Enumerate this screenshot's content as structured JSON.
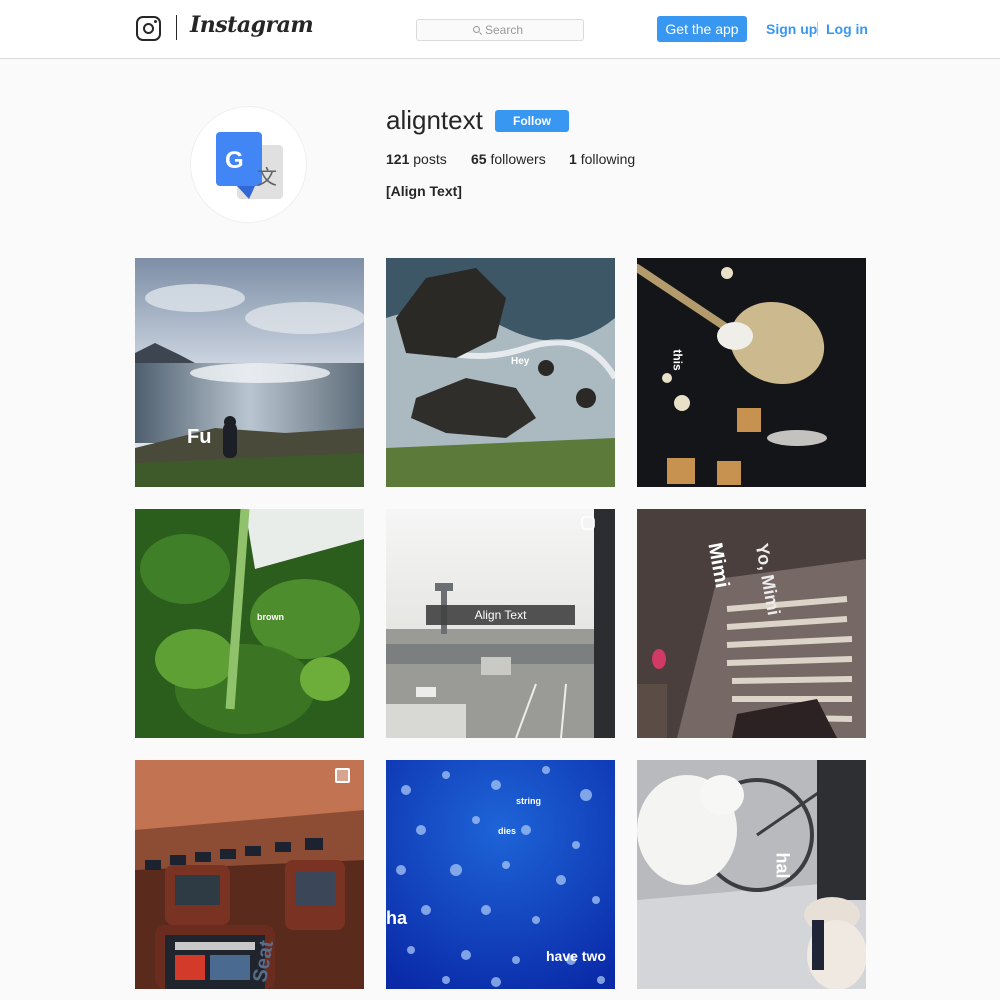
{
  "header": {
    "brand": "Instagram",
    "search_placeholder": "Search",
    "get_app_label": "Get the app",
    "signup_label": "Sign up",
    "login_label": "Log in"
  },
  "profile": {
    "username": "aligntext",
    "follow_label": "Follow",
    "stats": {
      "posts_count": "121",
      "posts_label": "posts",
      "followers_count": "65",
      "followers_label": "followers",
      "following_count": "1",
      "following_label": "following"
    },
    "bio": "[Align Text]",
    "avatar_icon": "google-translate-icon"
  },
  "posts": [
    {
      "overlay": "Fu"
    },
    {
      "overlay": "Hey"
    },
    {
      "overlay": "this"
    },
    {
      "overlay": "brown"
    },
    {
      "overlay": "Align Text",
      "badge": "video-icon"
    },
    {
      "overlay_1": "Mimi",
      "overlay_2": "Yo, Mimi"
    },
    {
      "overlay": "Seat",
      "badge": "multiple-photos-icon"
    },
    {
      "overlay_1": "ha",
      "overlay_2": "have two",
      "overlay_3": "string",
      "overlay_4": "dies"
    },
    {
      "overlay": "hal"
    }
  ],
  "colors": {
    "accent": "#3897f0",
    "text": "#262626",
    "background": "#fafafa"
  }
}
